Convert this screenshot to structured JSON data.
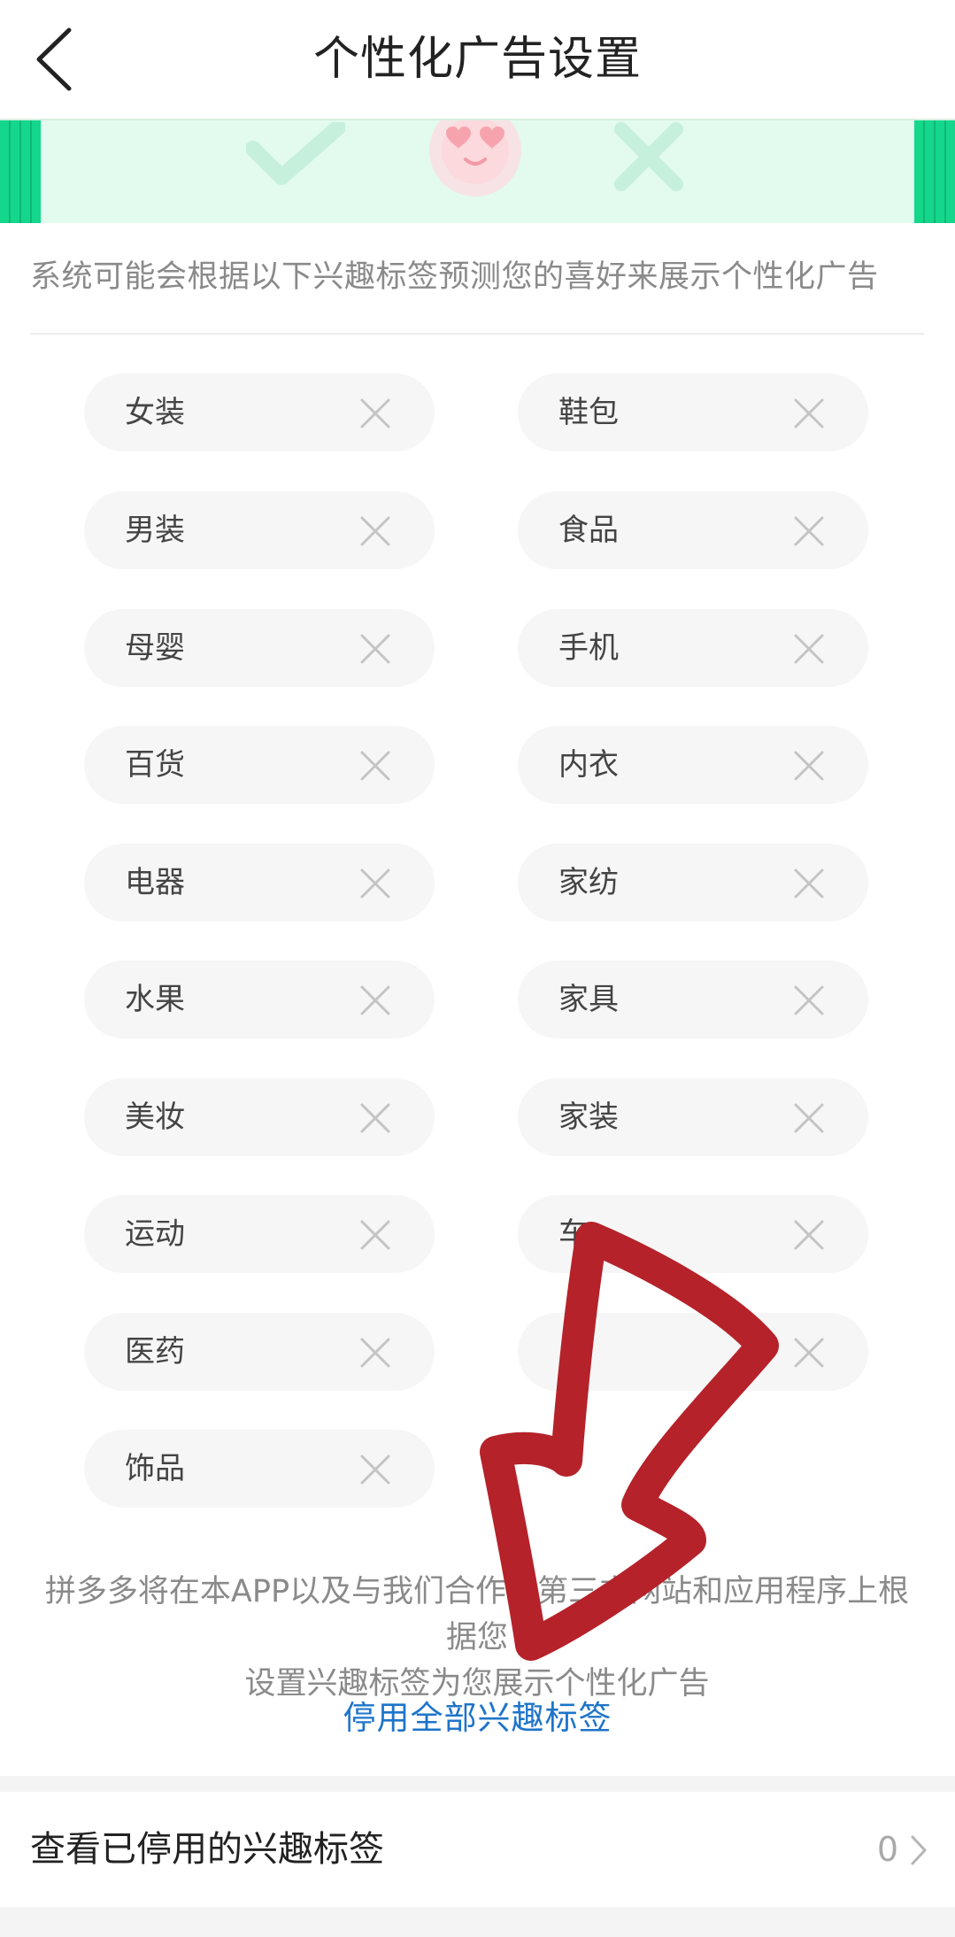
{
  "header": {
    "title": "个性化广告设置",
    "back_icon": "chevron-left-icon"
  },
  "banner": {
    "icons": [
      "check-icon",
      "heart-eyes-face-icon",
      "cross-icon"
    ],
    "accent_color": "#14d78c"
  },
  "intro": "系统可能会根据以下兴趣标签预测您的喜好来展示个性化广告",
  "tags": [
    {
      "label": "女装"
    },
    {
      "label": "鞋包"
    },
    {
      "label": "男装"
    },
    {
      "label": "食品"
    },
    {
      "label": "母婴"
    },
    {
      "label": "手机"
    },
    {
      "label": "百货"
    },
    {
      "label": "内衣"
    },
    {
      "label": "电器"
    },
    {
      "label": "家纺"
    },
    {
      "label": "水果"
    },
    {
      "label": "家具"
    },
    {
      "label": "美妆"
    },
    {
      "label": "家装"
    },
    {
      "label": "运动"
    },
    {
      "label": "车"
    },
    {
      "label": "医药"
    },
    {
      "label": ""
    },
    {
      "label": "饰品"
    }
  ],
  "footer_note": {
    "line1": "拼多多将在本APP以及与我们合作的第三方网站和应用程序上根据您",
    "line2": "设置兴趣标签为您展示个性化广告"
  },
  "disable_all_link": "停用全部兴趣标签",
  "disabled_row": {
    "label": "查看已停用的兴趣标签",
    "count": "0"
  },
  "colors": {
    "link": "#1e74c9",
    "annotation_arrow": "#b5222a"
  },
  "annotation": "red-arrow-pointing-to-disable-all-link"
}
